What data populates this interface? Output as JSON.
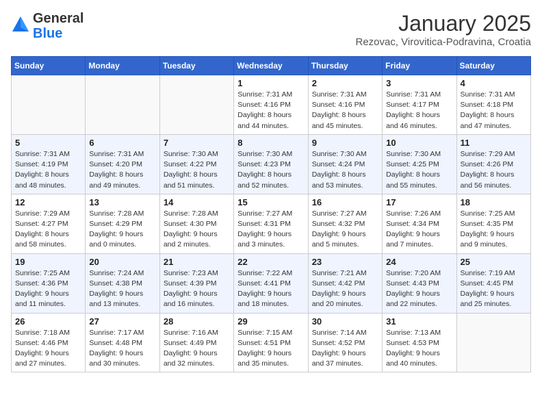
{
  "header": {
    "logo_general": "General",
    "logo_blue": "Blue",
    "month": "January 2025",
    "location": "Rezovac, Virovitica-Podravina, Croatia"
  },
  "weekdays": [
    "Sunday",
    "Monday",
    "Tuesday",
    "Wednesday",
    "Thursday",
    "Friday",
    "Saturday"
  ],
  "weeks": [
    [
      {
        "day": "",
        "info": ""
      },
      {
        "day": "",
        "info": ""
      },
      {
        "day": "",
        "info": ""
      },
      {
        "day": "1",
        "info": "Sunrise: 7:31 AM\nSunset: 4:16 PM\nDaylight: 8 hours\nand 44 minutes."
      },
      {
        "day": "2",
        "info": "Sunrise: 7:31 AM\nSunset: 4:16 PM\nDaylight: 8 hours\nand 45 minutes."
      },
      {
        "day": "3",
        "info": "Sunrise: 7:31 AM\nSunset: 4:17 PM\nDaylight: 8 hours\nand 46 minutes."
      },
      {
        "day": "4",
        "info": "Sunrise: 7:31 AM\nSunset: 4:18 PM\nDaylight: 8 hours\nand 47 minutes."
      }
    ],
    [
      {
        "day": "5",
        "info": "Sunrise: 7:31 AM\nSunset: 4:19 PM\nDaylight: 8 hours\nand 48 minutes."
      },
      {
        "day": "6",
        "info": "Sunrise: 7:31 AM\nSunset: 4:20 PM\nDaylight: 8 hours\nand 49 minutes."
      },
      {
        "day": "7",
        "info": "Sunrise: 7:30 AM\nSunset: 4:22 PM\nDaylight: 8 hours\nand 51 minutes."
      },
      {
        "day": "8",
        "info": "Sunrise: 7:30 AM\nSunset: 4:23 PM\nDaylight: 8 hours\nand 52 minutes."
      },
      {
        "day": "9",
        "info": "Sunrise: 7:30 AM\nSunset: 4:24 PM\nDaylight: 8 hours\nand 53 minutes."
      },
      {
        "day": "10",
        "info": "Sunrise: 7:30 AM\nSunset: 4:25 PM\nDaylight: 8 hours\nand 55 minutes."
      },
      {
        "day": "11",
        "info": "Sunrise: 7:29 AM\nSunset: 4:26 PM\nDaylight: 8 hours\nand 56 minutes."
      }
    ],
    [
      {
        "day": "12",
        "info": "Sunrise: 7:29 AM\nSunset: 4:27 PM\nDaylight: 8 hours\nand 58 minutes."
      },
      {
        "day": "13",
        "info": "Sunrise: 7:28 AM\nSunset: 4:29 PM\nDaylight: 9 hours\nand 0 minutes."
      },
      {
        "day": "14",
        "info": "Sunrise: 7:28 AM\nSunset: 4:30 PM\nDaylight: 9 hours\nand 2 minutes."
      },
      {
        "day": "15",
        "info": "Sunrise: 7:27 AM\nSunset: 4:31 PM\nDaylight: 9 hours\nand 3 minutes."
      },
      {
        "day": "16",
        "info": "Sunrise: 7:27 AM\nSunset: 4:32 PM\nDaylight: 9 hours\nand 5 minutes."
      },
      {
        "day": "17",
        "info": "Sunrise: 7:26 AM\nSunset: 4:34 PM\nDaylight: 9 hours\nand 7 minutes."
      },
      {
        "day": "18",
        "info": "Sunrise: 7:25 AM\nSunset: 4:35 PM\nDaylight: 9 hours\nand 9 minutes."
      }
    ],
    [
      {
        "day": "19",
        "info": "Sunrise: 7:25 AM\nSunset: 4:36 PM\nDaylight: 9 hours\nand 11 minutes."
      },
      {
        "day": "20",
        "info": "Sunrise: 7:24 AM\nSunset: 4:38 PM\nDaylight: 9 hours\nand 13 minutes."
      },
      {
        "day": "21",
        "info": "Sunrise: 7:23 AM\nSunset: 4:39 PM\nDaylight: 9 hours\nand 16 minutes."
      },
      {
        "day": "22",
        "info": "Sunrise: 7:22 AM\nSunset: 4:41 PM\nDaylight: 9 hours\nand 18 minutes."
      },
      {
        "day": "23",
        "info": "Sunrise: 7:21 AM\nSunset: 4:42 PM\nDaylight: 9 hours\nand 20 minutes."
      },
      {
        "day": "24",
        "info": "Sunrise: 7:20 AM\nSunset: 4:43 PM\nDaylight: 9 hours\nand 22 minutes."
      },
      {
        "day": "25",
        "info": "Sunrise: 7:19 AM\nSunset: 4:45 PM\nDaylight: 9 hours\nand 25 minutes."
      }
    ],
    [
      {
        "day": "26",
        "info": "Sunrise: 7:18 AM\nSunset: 4:46 PM\nDaylight: 9 hours\nand 27 minutes."
      },
      {
        "day": "27",
        "info": "Sunrise: 7:17 AM\nSunset: 4:48 PM\nDaylight: 9 hours\nand 30 minutes."
      },
      {
        "day": "28",
        "info": "Sunrise: 7:16 AM\nSunset: 4:49 PM\nDaylight: 9 hours\nand 32 minutes."
      },
      {
        "day": "29",
        "info": "Sunrise: 7:15 AM\nSunset: 4:51 PM\nDaylight: 9 hours\nand 35 minutes."
      },
      {
        "day": "30",
        "info": "Sunrise: 7:14 AM\nSunset: 4:52 PM\nDaylight: 9 hours\nand 37 minutes."
      },
      {
        "day": "31",
        "info": "Sunrise: 7:13 AM\nSunset: 4:53 PM\nDaylight: 9 hours\nand 40 minutes."
      },
      {
        "day": "",
        "info": ""
      }
    ]
  ]
}
